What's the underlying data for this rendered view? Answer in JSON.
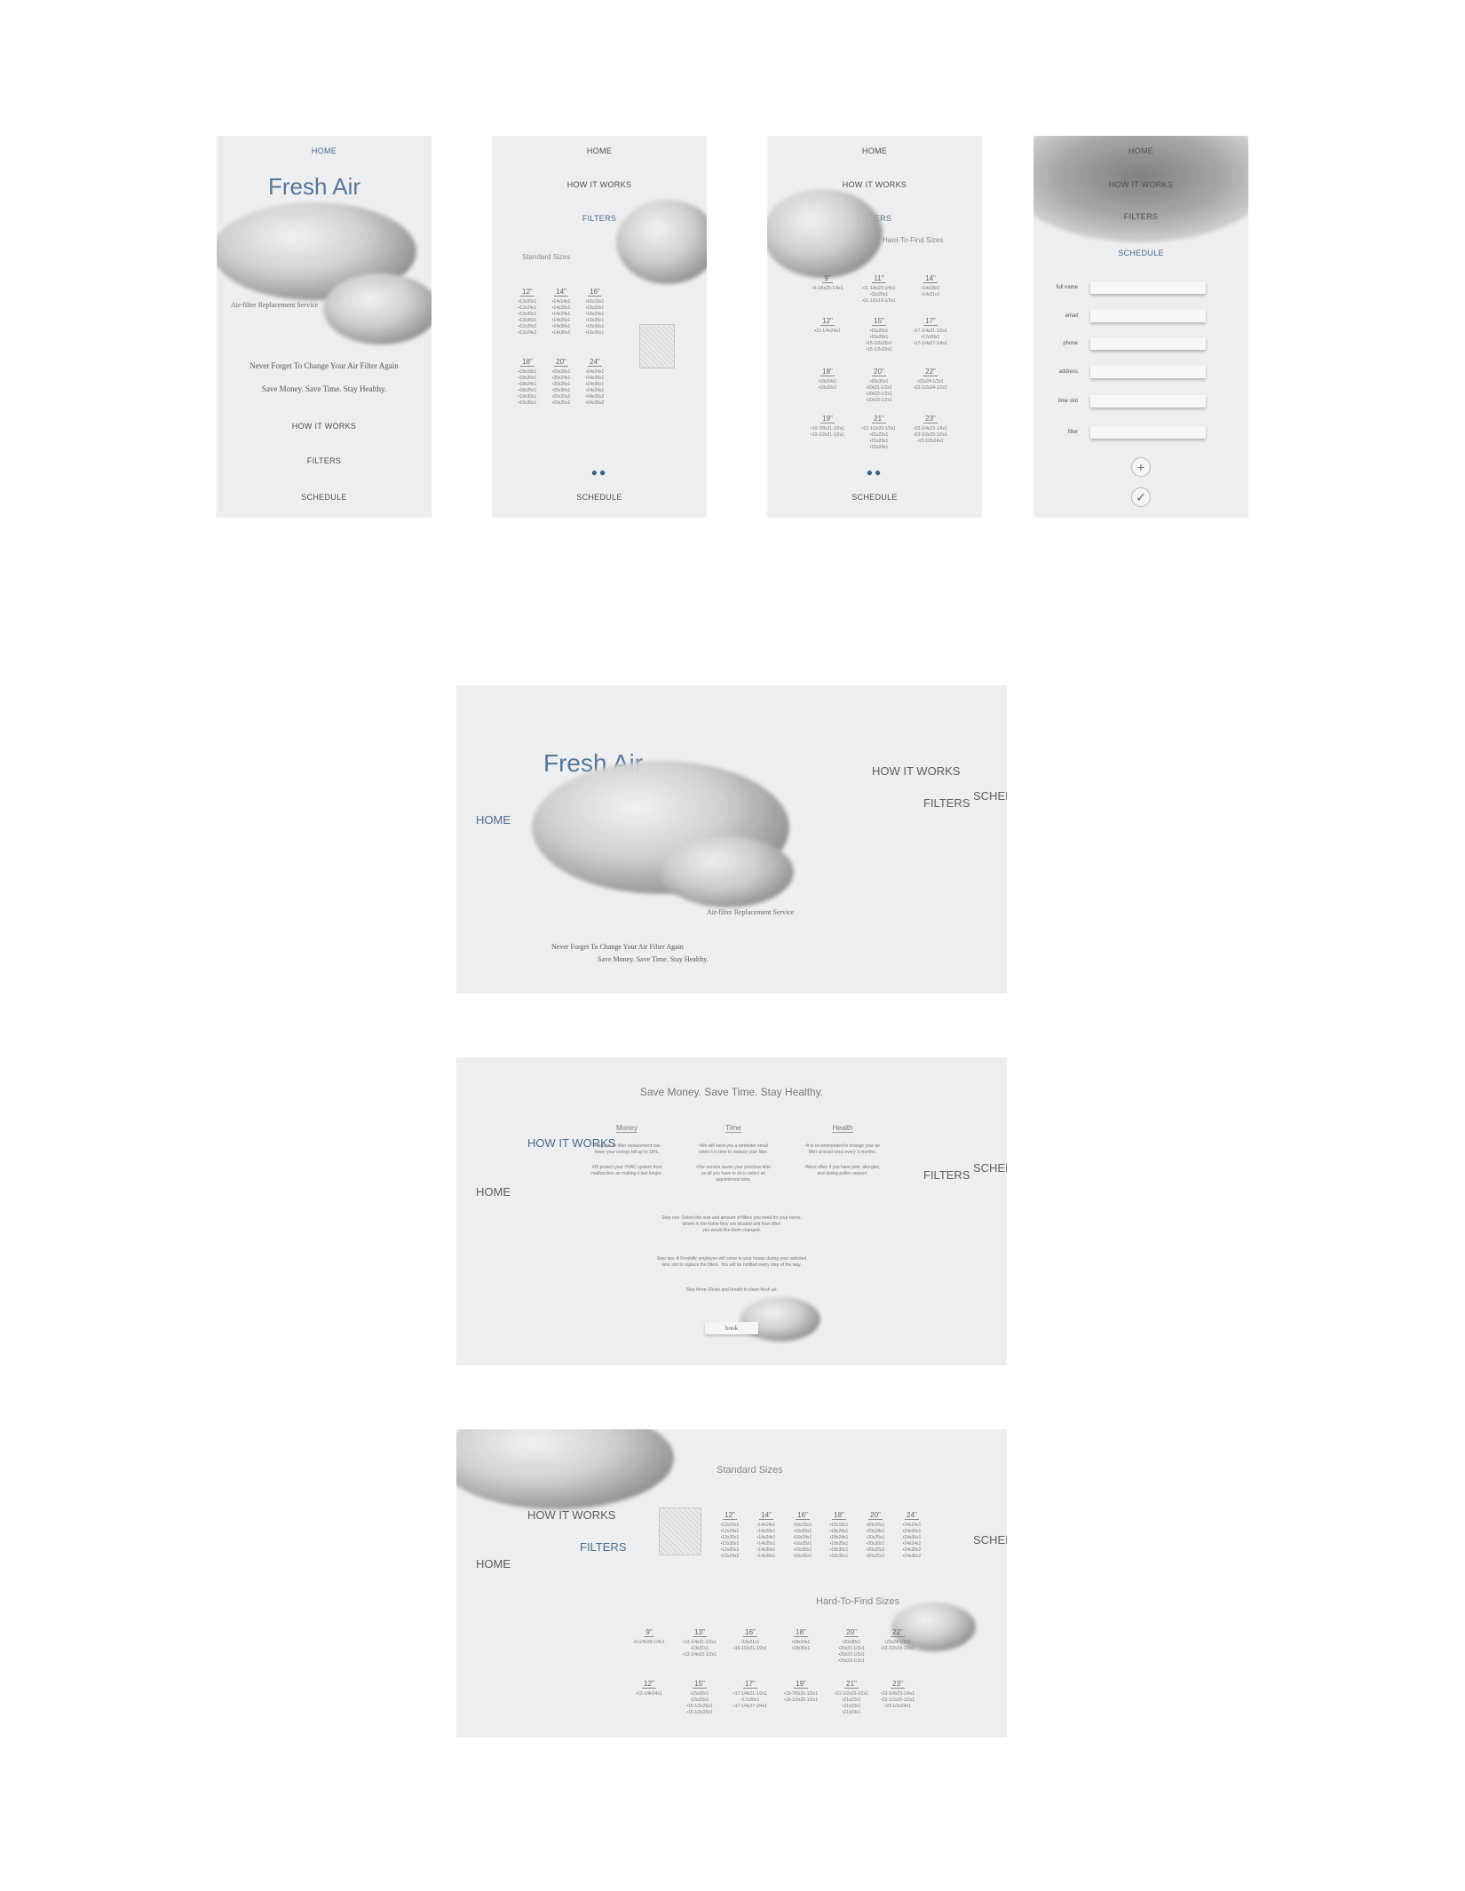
{
  "nav": {
    "home": "HOME",
    "how": "HOW IT WORKS",
    "filters": "FILTERS",
    "schedule": "SCHEDULE"
  },
  "vnav": {
    "home": "HOME",
    "how": "HOW IT WORKS",
    "filters": "FILTERS",
    "schedule": "SCHEDULE"
  },
  "brand": {
    "title": "Fresh Air",
    "subtitle": "Air-filter Replacement Service",
    "tag1": "Never Forget To Change Your Air Filter Again",
    "tag2": "Save Money. Save Time. Stay Healthy."
  },
  "standard": {
    "heading": "Standard Sizes",
    "groups": [
      {
        "size": "12\"",
        "items": "•12x20x1\n•12x24x1\n•12x30x1\n•12x36x1\n•12x20x2\n•12x24x2"
      },
      {
        "size": "14\"",
        "items": "•14x14x1\n•14x20x1\n•14x24x1\n•14x25x1\n•14x30x1\n•14x36x1"
      },
      {
        "size": "16\"",
        "items": "•16x16x1\n•16x20x1\n•16x24x1\n•16x25x1\n•16x30x1\n•16x36x1"
      },
      {
        "size": "18\"",
        "items": "•18x18x1\n•18x20x1\n•18x24x1\n•18x25x1\n•18x30x1\n•18x36x1"
      },
      {
        "size": "20\"",
        "items": "•20x20x1\n•20x24x1\n•20x25x1\n•20x30x1\n•20x20x2\n•20x25x2"
      },
      {
        "size": "24\"",
        "items": "•24x24x1\n•24x30x1\n•24x36x1\n•24x24x2\n•24x30x2\n•24x36x2"
      }
    ]
  },
  "hard": {
    "heading": "Hard-To-Find Sizes",
    "groups": [
      {
        "size": "9\"",
        "items": "•9-1/4x20-1/4x1"
      },
      {
        "size": "11\"",
        "items": "•11-1/4x23-1/4x1\n•11x20x1\n•11-1/2x19-1/2x1"
      },
      {
        "size": "12\"",
        "items": "•12-1/4x24x1"
      },
      {
        "size": "13\"",
        "items": "•13-1/4x21-1/2x1\n•13x21x1\n•13-1/4x23-1/2x1"
      },
      {
        "size": "14\"",
        "items": "•14x18x1\n•14x21x1"
      },
      {
        "size": "15\"",
        "items": "•15x20x1\n•15x20x1\n•15-1/2x25x1\n•15-1/2x20x1"
      },
      {
        "size": "16\"",
        "items": "•16x21x1\n•16-1/2x21-1/2x1"
      },
      {
        "size": "17\"",
        "items": "•17-1/4x21-1/2x1\n•17x20x1\n•17-1/4x27-1/4x1"
      },
      {
        "size": "18\"",
        "items": "•18x24x1\n•18x30x1"
      },
      {
        "size": "19\"",
        "items": "•19-7/8x21-1/2x1\n•19-1/2x21-1/2x1"
      },
      {
        "size": "20\"",
        "items": "•20x30x1\n•20x21-1/2x1\n•20x22-1/2x1\n•20x23-1/2x1"
      },
      {
        "size": "21\"",
        "items": "•21-1/2x23-1/2x1\n•21x22x1\n•21x23x1\n•21x24x1"
      },
      {
        "size": "22\"",
        "items": "•22x24-1/2x1\n•22-1/2x24-1/2x1"
      },
      {
        "size": "23\"",
        "items": "•23-1/4x23-1/4x1\n•23-1/2x25-1/2x1\n•23-1/2x24x1"
      }
    ]
  },
  "form": {
    "fields": [
      "full name",
      "email",
      "phone",
      "address",
      "time slot",
      "filter"
    ],
    "add": "+",
    "confirm": "✓"
  },
  "benefits": {
    "heading": "Save Money. Save Time. Stay Healthy.",
    "cols": [
      {
        "title": "Money",
        "p1": "•Regular air filter replacement can\nlower your energy bill up to 15%.",
        "p2": "•It'll protect your HVAC system from\nmalfunction an making it last longer."
      },
      {
        "title": "Time",
        "p1": "•We will send you a reminder email\nwhen it is time to replace your filter.",
        "p2": "•Our service saves your precious time\nas all you have to do is select an\nappointment time."
      },
      {
        "title": "Health",
        "p1": "•It is recommended to change your air\nfilter at least once every 3 months.",
        "p2": "•More often if you have pets, allergies,\nand during pollen season."
      }
    ],
    "step1": "Step one: Select the size and amount of filters you need for your home,\nwhere in the home they are located and how often\nyou would like them changed.",
    "step2": "Step two: A FreshAir employee will come to your house during your selected\ntime slot to replace the filters. You will be notified every step of the way.",
    "step3": "Step three: Relax and breath in clean fresh air.",
    "book": "book"
  }
}
